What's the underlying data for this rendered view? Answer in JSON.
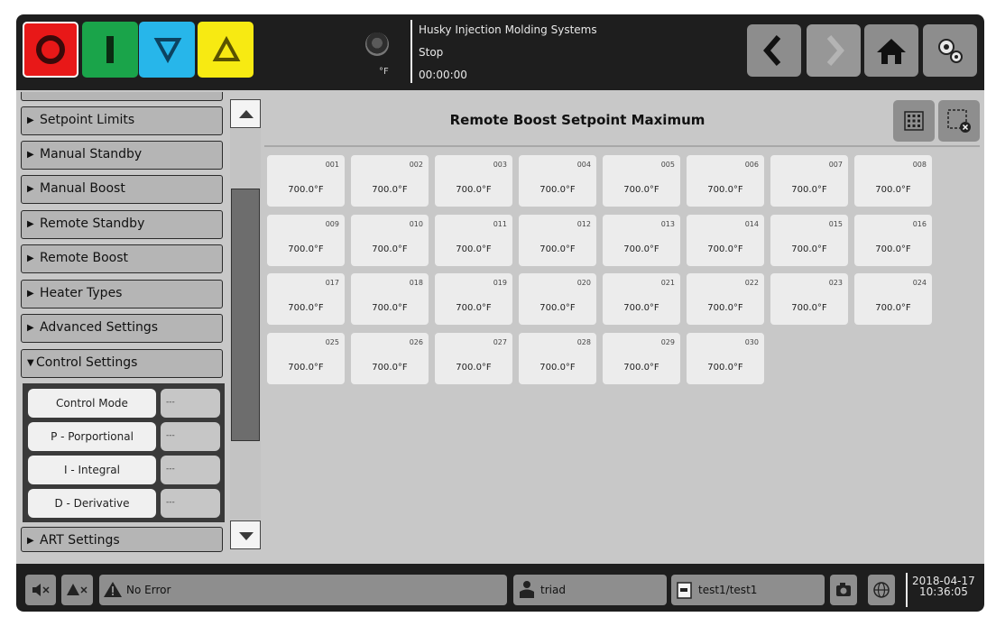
{
  "header": {
    "temperature_unit": "°F",
    "machine_name": "Husky Injection Molding Systems",
    "machine_state": "Stop",
    "cycle_timer": "00:00:00",
    "mode_buttons": [
      "stop-mode-icon",
      "run-mode-icon",
      "lower-mode-icon",
      "raise-mode-icon"
    ],
    "colors": {
      "stop": "#e81818",
      "run": "#1aa44a",
      "lower": "#27b6ea",
      "raise": "#f7ea12"
    }
  },
  "sidebar": {
    "items": [
      {
        "label": "Setpoint Limits",
        "expanded": false
      },
      {
        "label": "Manual Standby",
        "expanded": false
      },
      {
        "label": "Manual Boost",
        "expanded": false
      },
      {
        "label": "Remote Standby",
        "expanded": false
      },
      {
        "label": "Remote Boost",
        "expanded": false
      },
      {
        "label": "Heater Types",
        "expanded": false
      },
      {
        "label": "Advanced Settings",
        "expanded": false
      },
      {
        "label": "Control Settings",
        "expanded": true
      },
      {
        "label": "ART Settings",
        "expanded": false
      }
    ],
    "control_settings": [
      {
        "label": "Control Mode",
        "value": "---"
      },
      {
        "label": "P - Porportional",
        "value": "---"
      },
      {
        "label": "I - Integral",
        "value": "---"
      },
      {
        "label": "D - Derivative",
        "value": "---"
      }
    ]
  },
  "main": {
    "title": "Remote Boost Setpoint Maximum",
    "zones": [
      {
        "id": "001",
        "value": "700.0°F"
      },
      {
        "id": "002",
        "value": "700.0°F"
      },
      {
        "id": "003",
        "value": "700.0°F"
      },
      {
        "id": "004",
        "value": "700.0°F"
      },
      {
        "id": "005",
        "value": "700.0°F"
      },
      {
        "id": "006",
        "value": "700.0°F"
      },
      {
        "id": "007",
        "value": "700.0°F"
      },
      {
        "id": "008",
        "value": "700.0°F"
      },
      {
        "id": "009",
        "value": "700.0°F"
      },
      {
        "id": "010",
        "value": "700.0°F"
      },
      {
        "id": "011",
        "value": "700.0°F"
      },
      {
        "id": "012",
        "value": "700.0°F"
      },
      {
        "id": "013",
        "value": "700.0°F"
      },
      {
        "id": "014",
        "value": "700.0°F"
      },
      {
        "id": "015",
        "value": "700.0°F"
      },
      {
        "id": "016",
        "value": "700.0°F"
      },
      {
        "id": "017",
        "value": "700.0°F"
      },
      {
        "id": "018",
        "value": "700.0°F"
      },
      {
        "id": "019",
        "value": "700.0°F"
      },
      {
        "id": "020",
        "value": "700.0°F"
      },
      {
        "id": "021",
        "value": "700.0°F"
      },
      {
        "id": "022",
        "value": "700.0°F"
      },
      {
        "id": "023",
        "value": "700.0°F"
      },
      {
        "id": "024",
        "value": "700.0°F"
      },
      {
        "id": "025",
        "value": "700.0°F"
      },
      {
        "id": "026",
        "value": "700.0°F"
      },
      {
        "id": "027",
        "value": "700.0°F"
      },
      {
        "id": "028",
        "value": "700.0°F"
      },
      {
        "id": "029",
        "value": "700.0°F"
      },
      {
        "id": "030",
        "value": "700.0°F"
      }
    ]
  },
  "footer": {
    "error_text": "No Error",
    "user": "triad",
    "mold": "test1/test1",
    "date": "2018-04-17",
    "time": "10:36:05"
  }
}
